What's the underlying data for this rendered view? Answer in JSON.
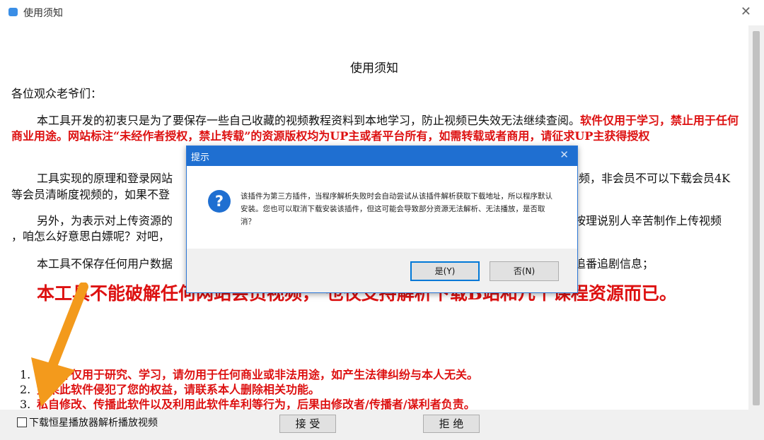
{
  "window": {
    "title": "使用须知",
    "close_glyph": "✕"
  },
  "document": {
    "heading": "使用须知",
    "greeting": "各位观众老爷们：",
    "para1_normal": "本工具开发的初衷只是为了要保存一些自己收藏的视频教程资料到本地学习，防止视频已失效无法继续查阅。",
    "para1_red": "软件仅用于学习，禁止用于任何商业用途。网站标注“未经作者授权，禁止转载”的资源版权均为UP主或者平台所有，如需转载或者商用，请征求UP主获得授权",
    "para2": "工具实现的原理和登录网站",
    "para2_tail": "频，非会员不可以下载会员4K",
    "para2_line2": "等会员清晰度视频的，如果不登",
    "para3": "另外，为表示对上传资源的",
    "para3_tail": "按理说别人辛苦制作上传视频",
    "para3_line2": "，咱怎么好意思白嫖呢？对吧，",
    "para4": "本工具不保存任何用户数据",
    "para4_tail": "追番追剧信息；",
    "big_red": "本工具不能破解任何网站会员视频，   也仅支持解析下载B站和几个课程资源而已。",
    "list": [
      {
        "num": "1.",
        "text": "本软件仅用于研究、学习，请勿用于任何商业或非法用途，如产生法律纠纷与本人无关。"
      },
      {
        "num": "2.",
        "text": "如果此软件侵犯了您的权益，请联系本人删除相关功能。"
      },
      {
        "num": "3.",
        "text": "私自修改、传播此软件以及利用此软件牟利等行为，后果由修改者/传播者/谋利者负责。"
      }
    ]
  },
  "footer": {
    "checkbox_label": "下载恒星播放器解析播放视频",
    "accept": "接 受",
    "reject": "拒 绝"
  },
  "dialog": {
    "title": "提示",
    "close_glyph": "✕",
    "icon_glyph": "?",
    "message": "该插件为第三方插件，当程序解析失败时会自动尝试从该插件解析获取下载地址，所以程序默认安装。您也可以取消下载安装该插件，但这可能会导致部分资源无法解析、无法播放，是否取消？",
    "yes": "是(Y)",
    "no": "否(N)"
  },
  "colors": {
    "accent": "#1f6fd1",
    "warning_red": "#d11111",
    "arrow": "#f39a1c"
  }
}
